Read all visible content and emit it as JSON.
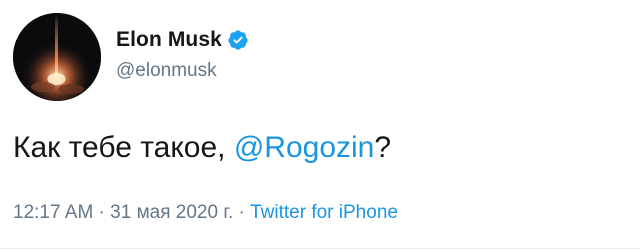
{
  "author": {
    "display_name": "Elon Musk",
    "handle": "@elonmusk",
    "verified": true
  },
  "tweet": {
    "text_before": "Как тебе такое, ",
    "mention": "@Rogozin",
    "text_after": "?"
  },
  "meta": {
    "time": "12:17 AM",
    "separator_1": " · ",
    "date": "31 мая 2020 г.",
    "separator_2": " · ",
    "source": "Twitter for iPhone"
  },
  "colors": {
    "text": "#14171a",
    "secondary": "#657786",
    "link": "#1b95e0",
    "verified_badge": "#1da1f2"
  },
  "icons": {
    "verified": "verified-badge-icon",
    "avatar": "rocket-launch-avatar"
  }
}
